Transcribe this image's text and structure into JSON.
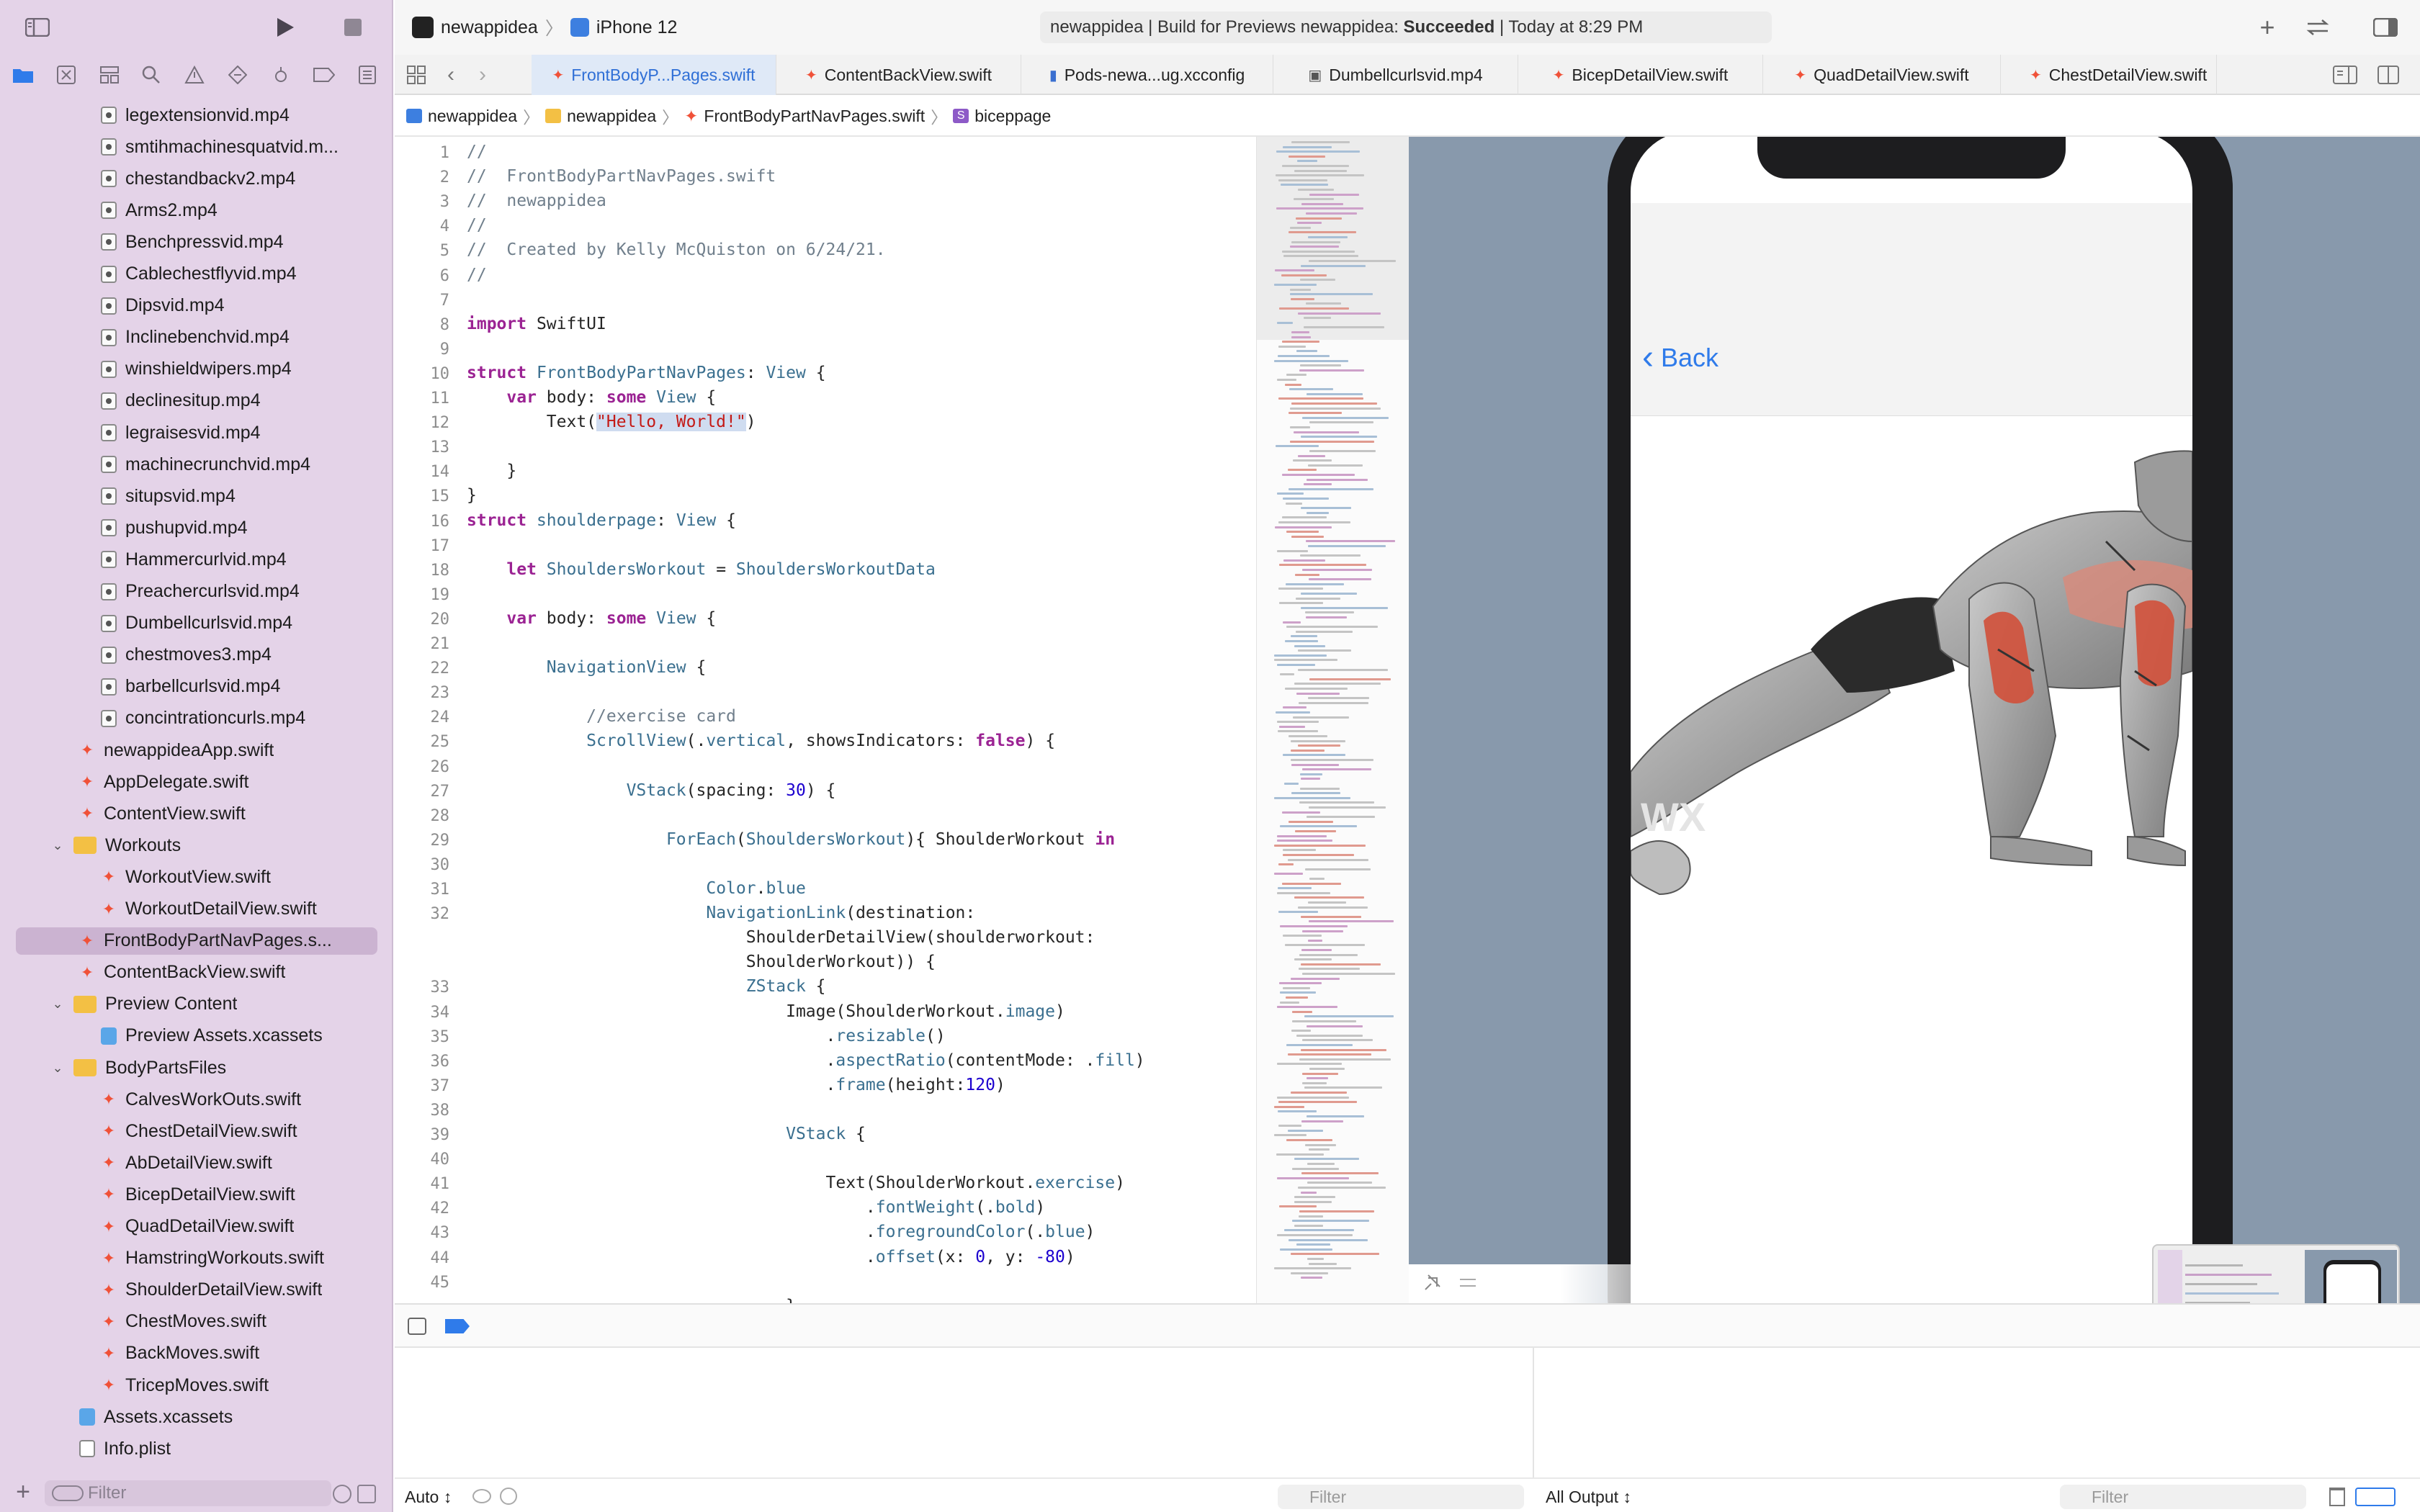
{
  "toolbar": {
    "scheme_project": "newappidea",
    "scheme_device": "iPhone 12",
    "activity_prefix": "newappidea | Build for Previews newappidea: ",
    "activity_status": "Succeeded",
    "activity_suffix": " | Today at 8:29 PM"
  },
  "tabs": [
    "FrontBodyP...Pages.swift",
    "ContentBackView.swift",
    "Pods-newa...ug.xcconfig",
    "Dumbellcurlsvid.mp4",
    "BicepDetailView.swift",
    "QuadDetailView.swift",
    "ChestDetailView.swift"
  ],
  "breadcrumb": [
    "newappidea",
    "newappidea",
    "FrontBodyPartNavPages.swift",
    "biceppage"
  ],
  "tree": [
    {
      "label": "legextensionvid.mp4",
      "type": "video",
      "depth": 2
    },
    {
      "label": "smtihmachinesquatvid.m...",
      "type": "video",
      "depth": 2
    },
    {
      "label": "chestandbackv2.mp4",
      "type": "video",
      "depth": 2
    },
    {
      "label": "Arms2.mp4",
      "type": "video",
      "depth": 2
    },
    {
      "label": "Benchpressvid.mp4",
      "type": "video",
      "depth": 2
    },
    {
      "label": "Cablechestflyvid.mp4",
      "type": "video",
      "depth": 2
    },
    {
      "label": "Dipsvid.mp4",
      "type": "video",
      "depth": 2
    },
    {
      "label": "Inclinebenchvid.mp4",
      "type": "video",
      "depth": 2
    },
    {
      "label": "winshieldwipers.mp4",
      "type": "video",
      "depth": 2
    },
    {
      "label": "declinesitup.mp4",
      "type": "video",
      "depth": 2
    },
    {
      "label": "legraisesvid.mp4",
      "type": "video",
      "depth": 2
    },
    {
      "label": "machinecrunchvid.mp4",
      "type": "video",
      "depth": 2
    },
    {
      "label": "situpsvid.mp4",
      "type": "video",
      "depth": 2
    },
    {
      "label": "pushupvid.mp4",
      "type": "video",
      "depth": 2
    },
    {
      "label": "Hammercurlvid.mp4",
      "type": "video",
      "depth": 2
    },
    {
      "label": "Preachercurlsvid.mp4",
      "type": "video",
      "depth": 2
    },
    {
      "label": "Dumbellcurlsvid.mp4",
      "type": "video",
      "depth": 2
    },
    {
      "label": "chestmoves3.mp4",
      "type": "video",
      "depth": 2
    },
    {
      "label": "barbellcurlsvid.mp4",
      "type": "video",
      "depth": 2
    },
    {
      "label": "concintrationcurls.mp4",
      "type": "video",
      "depth": 2
    },
    {
      "label": "newappideaApp.swift",
      "type": "swift",
      "depth": 1
    },
    {
      "label": "AppDelegate.swift",
      "type": "swift",
      "depth": 1
    },
    {
      "label": "ContentView.swift",
      "type": "swift",
      "depth": 1
    },
    {
      "label": "Workouts",
      "type": "folder",
      "depth": 0
    },
    {
      "label": "WorkoutView.swift",
      "type": "swift",
      "depth": 2
    },
    {
      "label": "WorkoutDetailView.swift",
      "type": "swift",
      "depth": 2
    },
    {
      "label": "FrontBodyPartNavPages.s...",
      "type": "swift",
      "depth": 1,
      "selected": true
    },
    {
      "label": "ContentBackView.swift",
      "type": "swift",
      "depth": 1
    },
    {
      "label": "Preview Content",
      "type": "folder",
      "depth": 0
    },
    {
      "label": "Preview Assets.xcassets",
      "type": "assets",
      "depth": 2
    },
    {
      "label": "BodyPartsFiles",
      "type": "folder",
      "depth": 0
    },
    {
      "label": "CalvesWorkOuts.swift",
      "type": "swift",
      "depth": 2
    },
    {
      "label": "ChestDetailView.swift",
      "type": "swift",
      "depth": 2
    },
    {
      "label": "AbDetailView.swift",
      "type": "swift",
      "depth": 2
    },
    {
      "label": "BicepDetailView.swift",
      "type": "swift",
      "depth": 2
    },
    {
      "label": "QuadDetailView.swift",
      "type": "swift",
      "depth": 2
    },
    {
      "label": "HamstringWorkouts.swift",
      "type": "swift",
      "depth": 2
    },
    {
      "label": "ShoulderDetailView.swift",
      "type": "swift",
      "depth": 2
    },
    {
      "label": "ChestMoves.swift",
      "type": "swift",
      "depth": 2
    },
    {
      "label": "BackMoves.swift",
      "type": "swift",
      "depth": 2
    },
    {
      "label": "TricepMoves.swift",
      "type": "swift",
      "depth": 2
    },
    {
      "label": "Assets.xcassets",
      "type": "assets",
      "depth": 1
    },
    {
      "label": "Info.plist",
      "type": "plist",
      "depth": 1
    }
  ],
  "sidebar_filter_placeholder": "Filter",
  "code": [
    {
      "n": "1",
      "t": [
        [
          "cm",
          "//"
        ]
      ]
    },
    {
      "n": "2",
      "t": [
        [
          "cm",
          "//  FrontBodyPartNavPages.swift"
        ]
      ]
    },
    {
      "n": "3",
      "t": [
        [
          "cm",
          "//  newappidea"
        ]
      ]
    },
    {
      "n": "4",
      "t": [
        [
          "cm",
          "//"
        ]
      ]
    },
    {
      "n": "5",
      "t": [
        [
          "cm",
          "//  Created by Kelly McQuiston on 6/24/21."
        ]
      ]
    },
    {
      "n": "6",
      "t": [
        [
          "cm",
          "//"
        ]
      ]
    },
    {
      "n": "7",
      "t": []
    },
    {
      "n": "8",
      "t": [
        [
          "kw",
          "import"
        ],
        [
          "",
          " SwiftUI"
        ]
      ]
    },
    {
      "n": "9",
      "t": []
    },
    {
      "n": "10",
      "t": [
        [
          "kw",
          "struct"
        ],
        [
          "",
          " "
        ],
        [
          "ty",
          "FrontBodyPartNavPages"
        ],
        [
          "",
          ": "
        ],
        [
          "ty",
          "View"
        ],
        [
          "",
          " {"
        ]
      ]
    },
    {
      "n": "11",
      "t": [
        [
          "",
          "    "
        ],
        [
          "kw",
          "var"
        ],
        [
          "",
          " body: "
        ],
        [
          "kw",
          "some"
        ],
        [
          "",
          " "
        ],
        [
          "ty",
          "View"
        ],
        [
          "",
          " {"
        ]
      ]
    },
    {
      "n": "12",
      "t": [
        [
          "",
          "        Text("
        ],
        [
          "st sel",
          "\"Hello, World!\""
        ],
        [
          "",
          ")"
        ]
      ]
    },
    {
      "n": "13",
      "t": []
    },
    {
      "n": "14",
      "t": [
        [
          "",
          "    }"
        ]
      ]
    },
    {
      "n": "15",
      "t": [
        [
          "",
          "}"
        ]
      ]
    },
    {
      "n": "16",
      "t": [
        [
          "kw",
          "struct"
        ],
        [
          "",
          " "
        ],
        [
          "ty",
          "shoulderpage"
        ],
        [
          "",
          ": "
        ],
        [
          "ty",
          "View"
        ],
        [
          "",
          " {"
        ]
      ]
    },
    {
      "n": "17",
      "t": []
    },
    {
      "n": "18",
      "t": [
        [
          "",
          "    "
        ],
        [
          "kw",
          "let"
        ],
        [
          "",
          " "
        ],
        [
          "ty",
          "ShouldersWorkout"
        ],
        [
          "",
          " = "
        ],
        [
          "ty",
          "ShouldersWorkoutData"
        ]
      ]
    },
    {
      "n": "19",
      "t": []
    },
    {
      "n": "20",
      "t": [
        [
          "",
          "    "
        ],
        [
          "kw",
          "var"
        ],
        [
          "",
          " body: "
        ],
        [
          "kw",
          "some"
        ],
        [
          "",
          " "
        ],
        [
          "ty",
          "View"
        ],
        [
          "",
          " {"
        ]
      ]
    },
    {
      "n": "21",
      "t": []
    },
    {
      "n": "22",
      "t": [
        [
          "",
          "        "
        ],
        [
          "ty",
          "NavigationView"
        ],
        [
          "",
          " {"
        ]
      ]
    },
    {
      "n": "23",
      "t": []
    },
    {
      "n": "24",
      "t": [
        [
          "",
          "            "
        ],
        [
          "cm",
          "//exercise card"
        ]
      ]
    },
    {
      "n": "25",
      "t": [
        [
          "",
          "            "
        ],
        [
          "ty",
          "ScrollView"
        ],
        [
          "",
          "(."
        ],
        [
          "ty",
          "vertical"
        ],
        [
          "",
          ", showsIndicators: "
        ],
        [
          "kw",
          "false"
        ],
        [
          "",
          ") {"
        ]
      ]
    },
    {
      "n": "26",
      "t": []
    },
    {
      "n": "27",
      "t": [
        [
          "",
          "                "
        ],
        [
          "ty",
          "VStack"
        ],
        [
          "",
          "(spacing: "
        ],
        [
          "nm",
          "30"
        ],
        [
          "",
          ") {"
        ]
      ]
    },
    {
      "n": "28",
      "t": []
    },
    {
      "n": "29",
      "t": [
        [
          "",
          "                    "
        ],
        [
          "ty",
          "ForEach"
        ],
        [
          "",
          "("
        ],
        [
          "ty",
          "ShouldersWorkout"
        ],
        [
          "",
          "){ ShoulderWorkout "
        ],
        [
          "kw",
          "in"
        ]
      ]
    },
    {
      "n": "30",
      "t": []
    },
    {
      "n": "31",
      "t": [
        [
          "",
          "                        "
        ],
        [
          "ty",
          "Color"
        ],
        [
          "",
          "."
        ],
        [
          "ty",
          "blue"
        ]
      ]
    },
    {
      "n": "32",
      "t": [
        [
          "",
          "                        "
        ],
        [
          "ty",
          "NavigationLink"
        ],
        [
          "",
          "(destination:"
        ]
      ]
    },
    {
      "n": "",
      "t": [
        [
          "",
          "                            ShoulderDetailView(shoulderworkout:"
        ]
      ]
    },
    {
      "n": "",
      "t": [
        [
          "",
          "                            ShoulderWorkout)) {"
        ]
      ]
    },
    {
      "n": "33",
      "t": [
        [
          "",
          "                            "
        ],
        [
          "ty",
          "ZStack"
        ],
        [
          "",
          " {"
        ]
      ]
    },
    {
      "n": "34",
      "t": [
        [
          "",
          "                                Image(ShoulderWorkout."
        ],
        [
          "ty",
          "image"
        ],
        [
          "",
          ")"
        ]
      ]
    },
    {
      "n": "35",
      "t": [
        [
          "",
          "                                    ."
        ],
        [
          "ty",
          "resizable"
        ],
        [
          "",
          "()"
        ]
      ]
    },
    {
      "n": "36",
      "t": [
        [
          "",
          "                                    ."
        ],
        [
          "ty",
          "aspectRatio"
        ],
        [
          "",
          "(contentMode: ."
        ],
        [
          "ty",
          "fill"
        ],
        [
          "",
          ")"
        ]
      ]
    },
    {
      "n": "37",
      "t": [
        [
          "",
          "                                    ."
        ],
        [
          "ty",
          "frame"
        ],
        [
          "",
          "(height:"
        ],
        [
          "nm",
          "120"
        ],
        [
          "",
          ")"
        ]
      ]
    },
    {
      "n": "38",
      "t": []
    },
    {
      "n": "39",
      "t": [
        [
          "",
          "                                "
        ],
        [
          "ty",
          "VStack"
        ],
        [
          "",
          " {"
        ]
      ]
    },
    {
      "n": "40",
      "t": []
    },
    {
      "n": "41",
      "t": [
        [
          "",
          "                                    Text(ShoulderWorkout."
        ],
        [
          "ty",
          "exercise"
        ],
        [
          "",
          ")"
        ]
      ]
    },
    {
      "n": "42",
      "t": [
        [
          "",
          "                                        ."
        ],
        [
          "ty",
          "fontWeight"
        ],
        [
          "",
          "(."
        ],
        [
          "ty",
          "bold"
        ],
        [
          "",
          ")"
        ]
      ]
    },
    {
      "n": "43",
      "t": [
        [
          "",
          "                                        ."
        ],
        [
          "ty",
          "foregroundColor"
        ],
        [
          "",
          "(."
        ],
        [
          "ty",
          "blue"
        ],
        [
          "",
          ")"
        ]
      ]
    },
    {
      "n": "44",
      "t": [
        [
          "",
          "                                        ."
        ],
        [
          "ty",
          "offset"
        ],
        [
          "",
          "(x: "
        ],
        [
          "nm",
          "0"
        ],
        [
          "",
          ", y: "
        ],
        [
          "nm",
          "-80"
        ],
        [
          "",
          ")"
        ]
      ]
    },
    {
      "n": "45",
      "t": []
    },
    {
      "n": "",
      "t": [
        [
          "",
          "                                }"
        ]
      ]
    }
  ],
  "preview": {
    "back_label": "Back",
    "watermark": "WX"
  },
  "debug": {
    "auto_label": "Auto ↕",
    "filter_placeholder": "Filter",
    "output_label": "All Output ↕"
  },
  "colors": {
    "sidebar_bg": "#e4d3e8",
    "accent": "#2f7bea",
    "canvas_bg": "#8899ac"
  }
}
